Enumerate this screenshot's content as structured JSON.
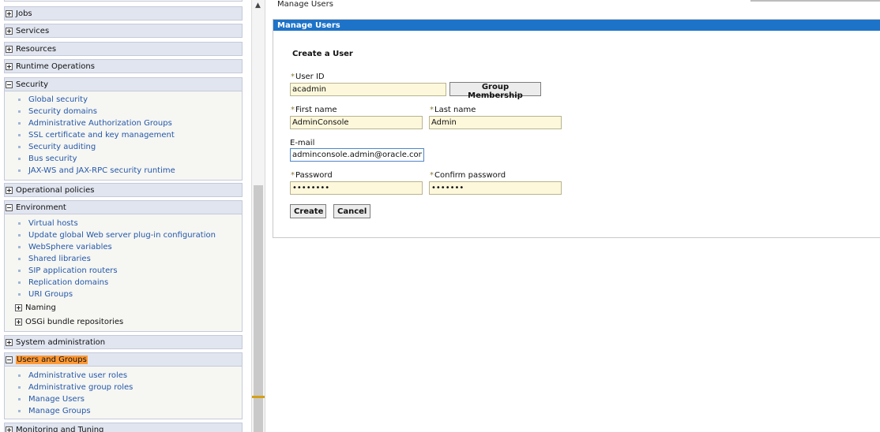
{
  "nav": {
    "jobs": "Jobs",
    "services": "Services",
    "resources": "Resources",
    "runtime_operations": "Runtime Operations",
    "security": {
      "label": "Security",
      "items": [
        "Global security",
        "Security domains",
        "Administrative Authorization Groups",
        "SSL certificate and key management",
        "Security auditing",
        "Bus security",
        "JAX-WS and JAX-RPC security runtime"
      ]
    },
    "operational_policies": "Operational policies",
    "environment": {
      "label": "Environment",
      "items": [
        "Virtual hosts",
        "Update global Web server plug-in configuration",
        "WebSphere variables",
        "Shared libraries",
        "SIP application routers",
        "Replication domains",
        "URI Groups"
      ],
      "subgroups": [
        "Naming",
        "OSGi bundle repositories"
      ]
    },
    "system_administration": "System administration",
    "users_and_groups": {
      "label": "Users and Groups",
      "items": [
        "Administrative user roles",
        "Administrative group roles",
        "Manage Users",
        "Manage Groups"
      ]
    },
    "monitoring_and_tuning": "Monitoring and Tuning"
  },
  "breadcrumb": "Manage Users",
  "panel": {
    "title": "Manage Users",
    "form_title": "Create a User",
    "required_marker": "*",
    "user_id": {
      "label": "User ID",
      "value": "acadmin"
    },
    "group_membership_button": "Group Membership",
    "first_name": {
      "label": "First name",
      "value": "AdminConsole"
    },
    "last_name": {
      "label": "Last name",
      "value": "Admin"
    },
    "email": {
      "label": "E-mail",
      "value": "adminconsole.admin@oracle.com"
    },
    "password": {
      "label": "Password",
      "value": "••••••••"
    },
    "confirm_password": {
      "label": "Confirm password",
      "value": "•••••••"
    },
    "create_button": "Create",
    "cancel_button": "Cancel"
  },
  "colors": {
    "title_bar": "#1d73c8",
    "input_bg": "#fdf8dc",
    "highlight": "#ff9a35",
    "link": "#2458a8"
  }
}
